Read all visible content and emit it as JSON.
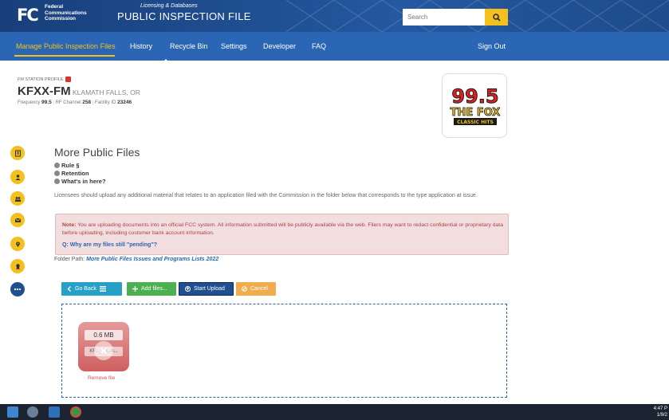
{
  "header": {
    "logo_text": "FC",
    "agency_lines": [
      "Federal",
      "Communications",
      "Commission"
    ],
    "subtitle": "Licensing & Databases",
    "title": "PUBLIC INSPECTION FILE",
    "search_placeholder": "Search"
  },
  "nav": {
    "items": [
      "Manage Public Inspection Files",
      "History",
      "Recycle Bin",
      "Settings",
      "Developer",
      "FAQ"
    ],
    "active": "Manage Public Inspection Files",
    "signout": "Sign Out"
  },
  "station": {
    "profile_label": "FM STATION PROFILE",
    "callsign": "KFXX-FM",
    "city": "KLAMATH FALLS, OR",
    "frequency_label": "Frequency",
    "frequency": "99.5",
    "rf_channel_label": "RF Channel",
    "rf_channel": "258",
    "facility_label": "Facility ID",
    "facility_id": "23246",
    "logo": {
      "number": "99.5",
      "name": "THE FOX",
      "tag": "CLASSIC HITS"
    }
  },
  "sidebar_icons": [
    "document-icon",
    "people-icon",
    "group-icon",
    "mail-icon",
    "location-icon",
    "award-icon",
    "more-icon"
  ],
  "main": {
    "title": "More Public Files",
    "help_links": [
      "Rule §",
      "Retention",
      "What's in here?"
    ],
    "description": "Licensees should upload any additional material that relates to an application filed with the Commission in the folder below that corresponds to the type application at issue.",
    "note_label": "Note:",
    "note_text": "You are uploading documents into an official FCC system. All information submitted will be publicly available via the web. Filers may want to redact confidential or proprietary data before uploading, including customer bank account information.",
    "note_question": "Q: Why are my files still \"pending\"?",
    "folder_label": "Folder Path:",
    "folder_path": "More Public Files Issues and Programs Lists 2022"
  },
  "buttons": {
    "go_back": "Go Back",
    "add_files": "Add files...",
    "start_upload": "Start Upload",
    "cancel": "Cancel"
  },
  "file": {
    "size": "0.6 MB",
    "name": "KF..._20...h...",
    "remove": "Remove file"
  },
  "taskbar": {
    "time": "4:47 P",
    "date": "1/9/2"
  },
  "colors": {
    "header_blue": "#1f4f91",
    "nav_blue": "#2a66b4",
    "accent_yellow": "#f4c01e",
    "note_bg": "#f2dede"
  }
}
